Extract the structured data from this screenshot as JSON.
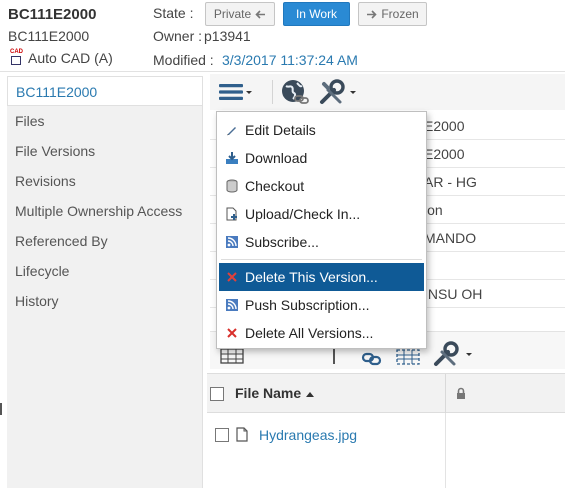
{
  "header": {
    "number": "BC111E2000",
    "name": "BC111E2000",
    "cad_label": "Auto CAD (A)",
    "cad_icon_text": "CAD",
    "state_label": "State :",
    "owner_label": "Owner :",
    "owner_value": "p13941",
    "modified_label": "Modified :",
    "modified_value": "3/3/2017 11:37:24 AM",
    "states": {
      "private": "Private",
      "in_work": "In Work",
      "frozen": "Frozen"
    }
  },
  "sidebar": {
    "items": [
      {
        "label": "BC111E2000"
      },
      {
        "label": "Files"
      },
      {
        "label": "File Versions"
      },
      {
        "label": "Revisions"
      },
      {
        "label": "Multiple Ownership Access"
      },
      {
        "label": "Referenced By"
      },
      {
        "label": "Lifecycle"
      },
      {
        "label": "History"
      }
    ]
  },
  "details": {
    "rows": [
      "E2000",
      "E2000",
      "AR - HG",
      "ion",
      "MANDO",
      "",
      "INSU OH"
    ]
  },
  "menu": {
    "items": [
      {
        "label": "Edit Details",
        "icon": "pencil-icon"
      },
      {
        "label": "Download",
        "icon": "download-icon"
      },
      {
        "label": "Checkout",
        "icon": "checkout-icon"
      },
      {
        "label": "Upload/Check In...",
        "icon": "upload-icon"
      },
      {
        "label": "Subscribe...",
        "icon": "rss-icon"
      },
      {
        "label": "Delete This Version...",
        "icon": "delete-x-icon"
      },
      {
        "label": "Push Subscription...",
        "icon": "rss-icon"
      },
      {
        "label": "Delete All Versions...",
        "icon": "delete-x-icon"
      }
    ]
  },
  "files": {
    "column_filename": "File Name",
    "rows": [
      {
        "name": "Hydrangeas.jpg"
      }
    ]
  },
  "colors": {
    "accent": "#2a8ad4",
    "menu_highlight": "#0f5a96",
    "link": "#2a7ab0",
    "delete": "#d9302c"
  }
}
